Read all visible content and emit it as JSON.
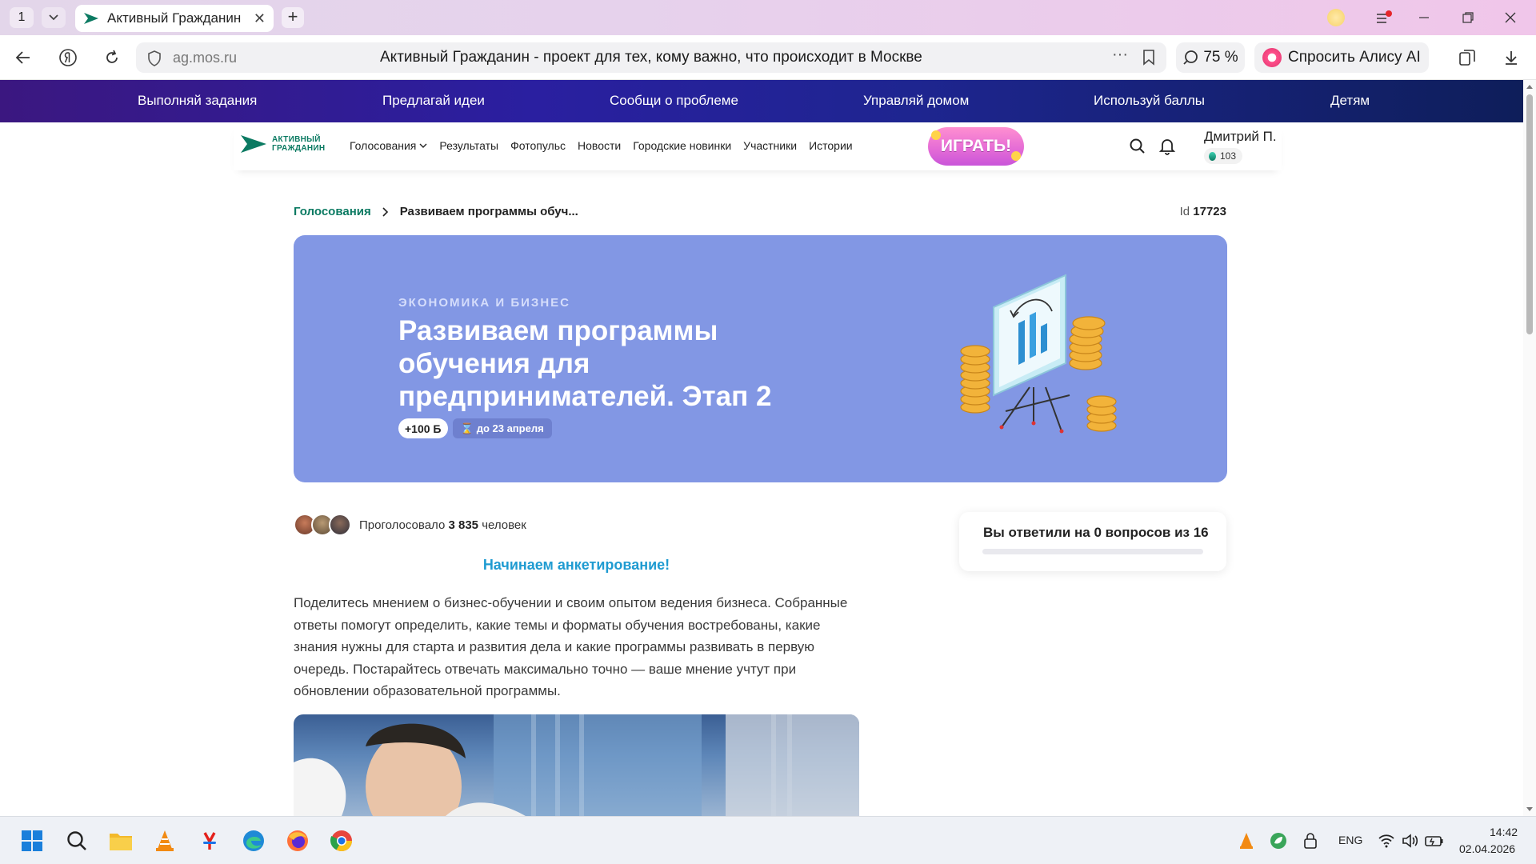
{
  "browser": {
    "tab_count": "1",
    "tab_title": "Активный Гражданин",
    "url_domain": "ag.mos.ru",
    "page_title": "Активный Гражданин - проект для тех, кому важно, что происходит в Москве",
    "zoom": "75 %",
    "alice_label": "Спросить Алису AI"
  },
  "promo_nav": [
    "Выполняй задания",
    "Предлагай идеи",
    "Сообщи о проблеме",
    "Управляй домом",
    "Используй баллы",
    "Детям"
  ],
  "header": {
    "logo_line1": "АКТИВНЫЙ",
    "logo_line2": "ГРАЖДАНИН",
    "nav": [
      "Голосования",
      "Результаты",
      "Фотопульс",
      "Новости",
      "Городские новинки",
      "Участники",
      "Истории"
    ],
    "play_label": "ИГРАТЬ!",
    "user_name": "Дмитрий П.",
    "user_points": "103"
  },
  "breadcrumb": {
    "parent": "Голосования",
    "current": "Развиваем программы обуч..."
  },
  "poll_id": {
    "label": "Id",
    "value": "17723"
  },
  "hero": {
    "category": "ЭКОНОМИКА И БИЗНЕС",
    "title": "Развиваем программы обучения для предпринимателей. Этап 2",
    "points": "+100 Б",
    "deadline": "до 23 апреля"
  },
  "voters": {
    "prefix": "Проголосовало",
    "count": "3 835",
    "suffix": "человек"
  },
  "intro_heading": "Начинаем анкетирование!",
  "description": "Поделитесь мнением о бизнес-обучении и своим опытом ведения бизнеса. Собранные ответы помогут определить, какие темы и форматы обучения востребованы, какие знания нужны для старта и развития дела и какие программы развивать в первую очередь. Постарайтесь отвечать максимально точно — ваше мнение учтут при обновлении образовательной программы.",
  "progress": {
    "text": "Вы ответили на 0 вопросов из 16",
    "answered": 0,
    "total": 16
  },
  "taskbar": {
    "lang": "ENG",
    "time": "14:42",
    "date": "02.04.2026"
  },
  "colors": {
    "brand_green": "#0b7a62",
    "hero_bg": "#8297e4",
    "link_blue": "#1f9bd1"
  }
}
